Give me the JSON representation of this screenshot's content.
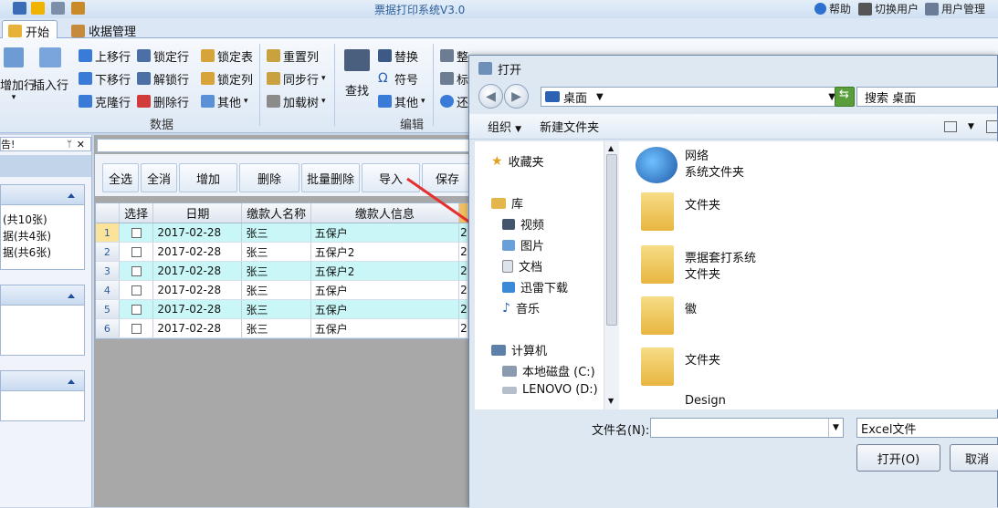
{
  "app": {
    "title": "票据打印系统V3.0",
    "title_prefix_hidden": "",
    "top_right": [
      "帮助",
      "切换用户",
      "用户管理"
    ]
  },
  "tabs": [
    {
      "label": "开始",
      "active": true
    },
    {
      "label": "收据管理",
      "active": false
    }
  ],
  "ribbon": {
    "big_add": "增加行",
    "big_insert": "插入行",
    "col1": [
      "上移行",
      "下移行",
      "克隆行"
    ],
    "col2": [
      "锁定行",
      "解锁行",
      "删除行"
    ],
    "col3": [
      "锁定表",
      "锁定列",
      "其他"
    ],
    "col4": [
      "重置列",
      "同步行",
      "加载树"
    ],
    "group_data": "数据",
    "big_find": "查找",
    "col5": [
      "替换",
      "符号",
      "其他"
    ],
    "group_edit": "编辑",
    "col6": [
      "整",
      "标",
      "还"
    ]
  },
  "left_panel": {
    "header": "告!",
    "items": [
      "(共10张)",
      "据(共4张)",
      "据(共6张)"
    ]
  },
  "toolbar": [
    "全选",
    "全消",
    "增加",
    "删除",
    "批量删除",
    "导入",
    "保存"
  ],
  "grid": {
    "columns": [
      "选择",
      "日期",
      "缴款人名称",
      "缴款人信息"
    ],
    "rows": [
      {
        "n": "1",
        "date": "2017-02-28",
        "name": "张三",
        "info": "五保户",
        "extra": "2"
      },
      {
        "n": "2",
        "date": "2017-02-28",
        "name": "张三",
        "info": "五保户2",
        "extra": "2"
      },
      {
        "n": "3",
        "date": "2017-02-28",
        "name": "张三",
        "info": "五保户2",
        "extra": "2"
      },
      {
        "n": "4",
        "date": "2017-02-28",
        "name": "张三",
        "info": "五保户",
        "extra": "2"
      },
      {
        "n": "5",
        "date": "2017-02-28",
        "name": "张三",
        "info": "五保户",
        "extra": "2"
      },
      {
        "n": "6",
        "date": "2017-02-28",
        "name": "张三",
        "info": "五保户",
        "extra": "2"
      }
    ]
  },
  "dialog": {
    "title": "打开",
    "address": "桌面",
    "search_placeholder": "搜索 桌面",
    "organize": "组织",
    "new_folder": "新建文件夹",
    "nav": {
      "favorites": "收藏夹",
      "libraries": "库",
      "video": "视频",
      "pictures": "图片",
      "documents": "文档",
      "thunder": "迅雷下载",
      "music": "音乐",
      "computer": "计算机",
      "disk_c": "本地磁盘 (C:)",
      "disk_d": "LENOVO (D:)"
    },
    "files": [
      {
        "name": "网络",
        "type": "系统文件夹"
      },
      {
        "name": "",
        "type": "文件夹"
      },
      {
        "name": "票据套打系统",
        "type": "文件夹"
      },
      {
        "name": "徽",
        "type": ""
      },
      {
        "name": "",
        "type": "文件夹"
      },
      {
        "name": "Design",
        "type": ""
      }
    ],
    "filename_label": "文件名(N):",
    "filename_value": "",
    "filetype": "Excel文件",
    "open_btn": "打开(O)",
    "cancel_btn": "取消"
  },
  "colors": {
    "ribbon_bg": "#dde8f5",
    "row_alt": "#c9f6f6",
    "arrow": "#e53030"
  }
}
